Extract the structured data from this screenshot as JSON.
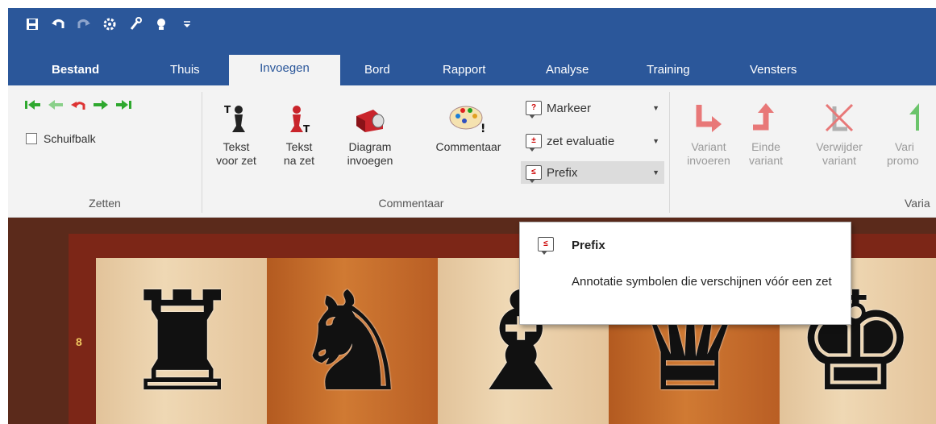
{
  "quick_access": {
    "icons": [
      "save-icon",
      "undo-icon",
      "redo-icon",
      "engine-icon",
      "tools-icon",
      "lightbulb-icon",
      "customize-dropdown-icon"
    ]
  },
  "tabs": [
    {
      "label": "Bestand",
      "active": false
    },
    {
      "label": "Thuis",
      "active": false
    },
    {
      "label": "Invoegen",
      "active": true
    },
    {
      "label": "Bord",
      "active": false
    },
    {
      "label": "Rapport",
      "active": false
    },
    {
      "label": "Analyse",
      "active": false
    },
    {
      "label": "Training",
      "active": false
    },
    {
      "label": "Vensters",
      "active": false
    }
  ],
  "ribbon": {
    "zetten": {
      "label": "Zetten",
      "checkbox_label": "Schuifbalk"
    },
    "commentaar": {
      "label": "Commentaar",
      "tekst_voor_zet": [
        "Tekst",
        "voor zet"
      ],
      "tekst_na_zet": [
        "Tekst",
        "na zet"
      ],
      "diagram_invoegen": [
        "Diagram",
        "invoegen"
      ],
      "commentaar_btn": [
        "Commentaar"
      ],
      "markeer": "Markeer",
      "zet_evaluatie": "zet evaluatie",
      "prefix": "Prefix"
    },
    "varianten": {
      "label": "Varia",
      "variant_invoeren": [
        "Variant",
        "invoeren"
      ],
      "einde_variant": [
        "Einde",
        "variant"
      ],
      "verwijder_variant": [
        "Verwijder",
        "variant"
      ],
      "variant_promoveren": [
        "Vari",
        "promo"
      ]
    }
  },
  "board": {
    "rank_label": "8"
  },
  "tooltip": {
    "title": "Prefix",
    "description": "Annotatie symbolen die verschijnen vóór een zet"
  },
  "colors": {
    "accent": "#2b579a",
    "ribbon_bg": "#f3f3f3",
    "board_frame": "#7c2617"
  }
}
